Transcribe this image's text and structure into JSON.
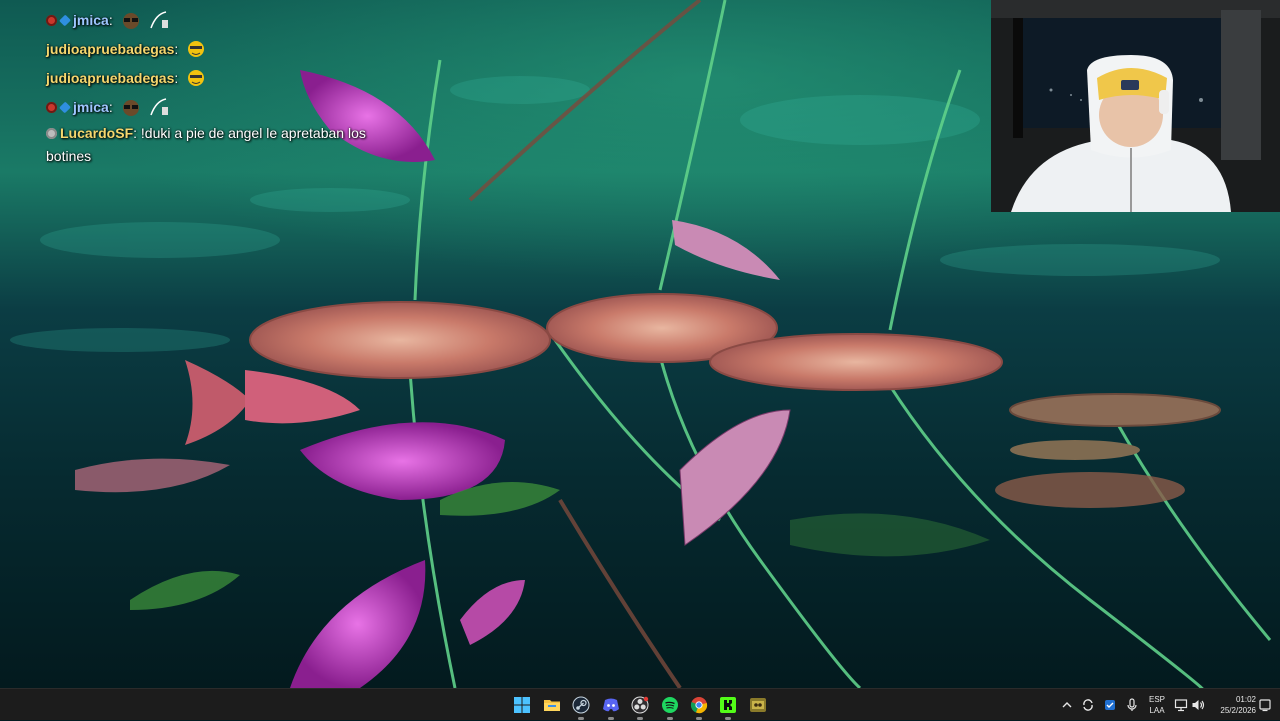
{
  "chat": {
    "messages": [
      {
        "badges": [
          "red",
          "blue"
        ],
        "user": "jmica",
        "user_color": "#9ec6ff",
        "text": "",
        "emotes": [
          "glasses-guy-emote",
          "broom-emote"
        ]
      },
      {
        "badges": [],
        "user": "judioapruebadegas",
        "user_color": "#f5d76e",
        "text": "",
        "emotes": [
          "yellow-face-emote"
        ]
      },
      {
        "badges": [],
        "user": "judioapruebadegas",
        "user_color": "#f5d76e",
        "text": "",
        "emotes": [
          "yellow-face-emote"
        ]
      },
      {
        "badges": [
          "red",
          "blue"
        ],
        "user": "jmica",
        "user_color": "#9ec6ff",
        "text": "",
        "emotes": [
          "glasses-guy-emote",
          "broom-emote"
        ]
      },
      {
        "badges": [
          "grey"
        ],
        "user": "LucardoSF",
        "user_color": "#f5d76e",
        "text": "!duki a pie de angel le apretaban los botines",
        "emotes": []
      }
    ],
    "separator": ":"
  },
  "taskbar": {
    "apps": [
      {
        "name": "start-button",
        "icon": "windows-logo-icon"
      },
      {
        "name": "file-explorer",
        "icon": "folder-icon"
      },
      {
        "name": "steam",
        "icon": "steam-icon"
      },
      {
        "name": "discord",
        "icon": "discord-icon"
      },
      {
        "name": "obs",
        "icon": "obs-icon"
      },
      {
        "name": "spotify",
        "icon": "spotify-icon"
      },
      {
        "name": "chrome",
        "icon": "chrome-icon"
      },
      {
        "name": "kick",
        "icon": "kick-icon"
      },
      {
        "name": "game-app",
        "icon": "game-icon"
      }
    ],
    "tray": {
      "language_line1": "ESP",
      "language_line2": "LAA",
      "time": "01:02",
      "date": "25/2/2026"
    }
  },
  "colors": {
    "taskbar_bg": "#1c1c1c",
    "accent_blue": "#4cc2ff",
    "kick_green": "#53fc18",
    "spotify_green": "#1ed760"
  }
}
